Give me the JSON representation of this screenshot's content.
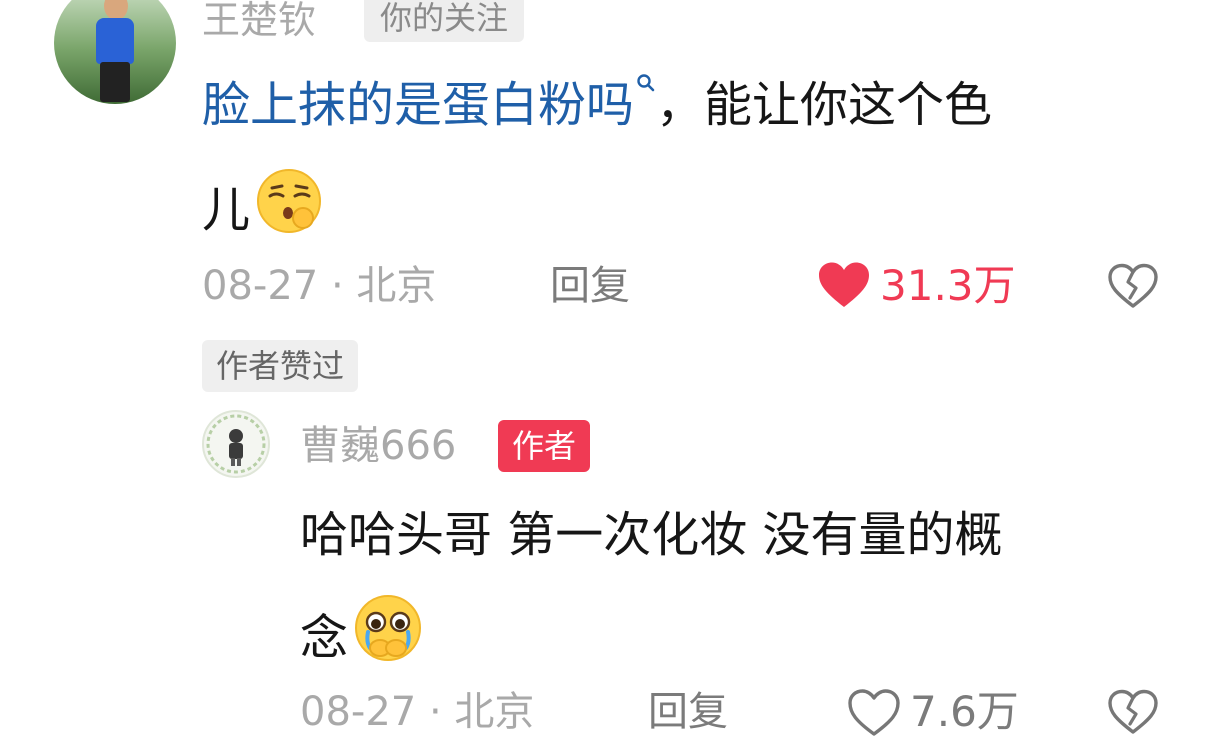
{
  "comment1": {
    "username": "王楚钦",
    "follow_tag": "你的关注",
    "search_text": "脸上抹的是蛋白粉吗",
    "text_rest": "，能让你这个色",
    "text_line2": "儿",
    "emoji": "smirk-emoji",
    "date": "08-27",
    "separator": "·",
    "location": "北京",
    "reply_label": "回复",
    "like_count": "31.3万",
    "liked": true,
    "liked_color": "#f03a54",
    "liked_by_author_tag": "作者赞过"
  },
  "reply": {
    "username": "曹巍666",
    "author_badge": "作者",
    "text_line1": "哈哈头哥 第一次化妆 没有量的概",
    "text_line2": "念",
    "emoji": "teary-face-emoji",
    "date": "08-27",
    "separator": "·",
    "location": "北京",
    "reply_label": "回复",
    "like_count": "7.6万",
    "liked": false
  }
}
